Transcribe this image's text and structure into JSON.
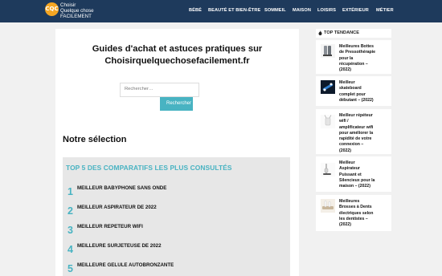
{
  "header": {
    "logo_initials": "CQC",
    "logo_lines": [
      "Choisir",
      "Quelque chose",
      "FACILEMENT"
    ],
    "nav": [
      "BÉBÉ",
      "BEAUTÉ ET BIEN-ÊTRE",
      "SOMMEIL",
      "MAISON",
      "LOISIRS",
      "EXTÉRIEUR",
      "MÉTIER"
    ]
  },
  "main": {
    "headline_line1": "Guides d'achat et astuces pratiques sur",
    "headline_line2": "Choisirquelquechosefacilement.fr",
    "search_placeholder": "Rechercher…",
    "search_button": "Rechercher",
    "selection_title": "Notre sélection",
    "top5_title": "TOP 5 DES COMPARATIFS LES PLUS CONSULTÉS",
    "top5": [
      {
        "num": "1",
        "label": "MEILLEUR BABYPHONE SANS ONDE"
      },
      {
        "num": "2",
        "label": "MEILLEUR ASPIRATEUR DE 2022"
      },
      {
        "num": "3",
        "label": "MEILLEUR REPETEUR WIFI"
      },
      {
        "num": "4",
        "label": "MEILLEURE SURJETEUSE DE 2022"
      },
      {
        "num": "5",
        "label": "MEILLEURE GELULE AUTOBRONZANTE"
      }
    ]
  },
  "sidebar": {
    "title": "TOP TENDANCE",
    "items": [
      {
        "lines": [
          "Meilleures Bottes",
          "de Pressothérapie",
          "pour la",
          "récupération –",
          "(2022)"
        ]
      },
      {
        "lines": [
          "Meilleur",
          "skateboard",
          "complet pour",
          "débutant – (2022)"
        ]
      },
      {
        "lines": [
          "Meilleur répéteur",
          "wifi /",
          "amplificateur wifi",
          "pour améliorer la",
          "rapidité de votre",
          "connexion –",
          "(2022)"
        ]
      },
      {
        "lines": [
          "Meilleur",
          "Aspirateur",
          "Puissant et",
          "Silencieux pour la",
          "maison – (2022)"
        ]
      },
      {
        "lines": [
          "Meilleures",
          "Brosses à Dents",
          "électriques selon",
          "les dentistes –",
          "(2022)"
        ]
      }
    ]
  }
}
